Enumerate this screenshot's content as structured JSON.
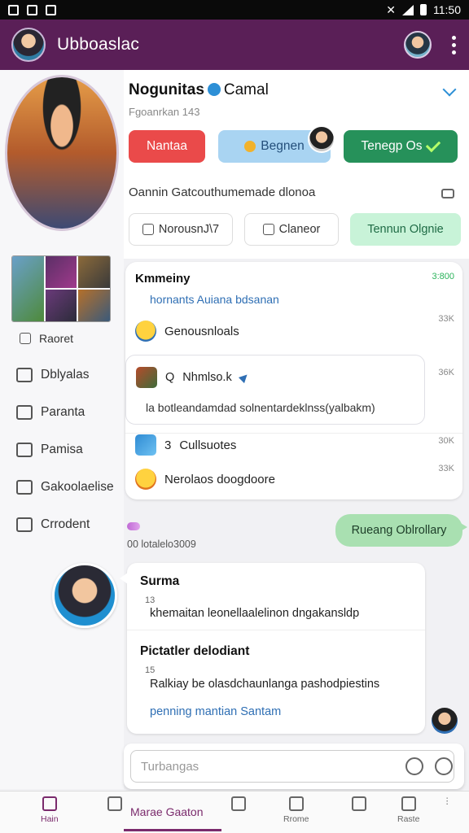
{
  "status_bar": {
    "time": "11:50"
  },
  "header": {
    "title": "Ubboaslac"
  },
  "profile": {
    "name": "Nogunitas",
    "name_suffix": "Camal",
    "subtitle": "Fgoanrkan 143",
    "buttons": {
      "red": "Nantaa",
      "blue": "Begnen",
      "green": "Tenegp Os"
    },
    "tagline": "Oannin Gatcouthumemade dlonoa",
    "pills": [
      "NorousnJ\\7",
      "Claneor",
      "Tennun Olgnie"
    ]
  },
  "sidebar": {
    "items": [
      {
        "label": "Raoret",
        "icon": "info-icon"
      },
      {
        "label": "Dblyalas",
        "icon": "calendar-icon"
      },
      {
        "label": "Paranta",
        "icon": "mail-icon"
      },
      {
        "label": "Pamisa",
        "icon": "edit-icon"
      },
      {
        "label": "Gakoolaelise",
        "icon": "settings-icon"
      },
      {
        "label": "Crrodent",
        "icon": "document-icon"
      }
    ]
  },
  "feed": {
    "card_title": "Kmmeiny",
    "card_subtitle": "hornants Auiana bdsanan",
    "time_green": "3:800",
    "time_1": "33K",
    "time_2": "36K",
    "time_3": "30K",
    "time_4": "33K",
    "row1": "Genousnloals",
    "nested_title": "Nhmlso.k",
    "nested_prefix": "Q",
    "nested_text": "la botleandamdad solnentardeklnss(yalbakm)",
    "row3_prefix": "3",
    "row3": "Cullsuotes",
    "row4": "Nerolaos doogdoore"
  },
  "sent_message": "Rueang Oblrollary",
  "meta": "00 lotalelo3009",
  "received": {
    "title1": "Surma",
    "num1": "13",
    "text1": "khemaitan leonellaalelinon dngakansldp",
    "title2": "Pictatler delodiant",
    "num2": "15",
    "text2": "Ralkiay be olasdchaunlanga pashodpiestins",
    "link2": "penning mantian Santam"
  },
  "composer": {
    "placeholder": "Turbangas"
  },
  "bottom_nav": {
    "home": "Hain",
    "middle": "Marae Gaaton",
    "item3": "Rrome",
    "item4": "Raste"
  }
}
